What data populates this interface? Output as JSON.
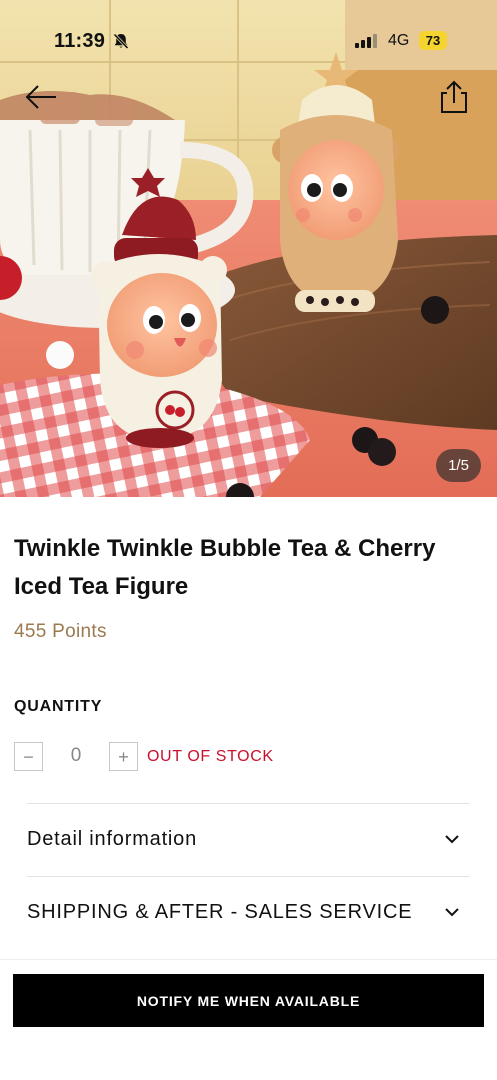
{
  "status_bar": {
    "time": "11:39",
    "network": "4G",
    "battery": "73",
    "icons": [
      "bell-slash-icon",
      "signal-bars-icon"
    ]
  },
  "header": {
    "back_icon": "arrow-left-icon",
    "share_icon": "share-icon"
  },
  "gallery": {
    "counter": "1/5",
    "current_index": 1,
    "total_images": 5,
    "figure_labels": [
      "Milk Tea",
      "Cherry"
    ]
  },
  "product": {
    "title": "Twinkle Twinkle Bubble Tea & Cherry Iced Tea Figure",
    "price": "455 Points",
    "price_color": "#9b7a4f"
  },
  "quantity": {
    "label": "QUANTITY",
    "minus": "−",
    "value": "0",
    "plus": "+",
    "stock_status": "OUT OF STOCK",
    "stock_color": "#c8102e"
  },
  "sections": [
    {
      "label": "Detail information",
      "icon": "chevron-down-icon"
    },
    {
      "label": "SHIPPING & AFTER - SALES SERVICE",
      "icon": "chevron-down-icon"
    }
  ],
  "cta": {
    "label": "NOTIFY ME WHEN AVAILABLE",
    "color": "#000000"
  }
}
